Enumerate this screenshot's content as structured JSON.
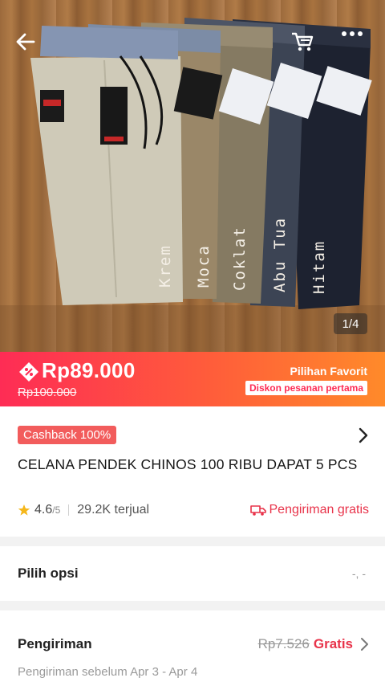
{
  "gallery": {
    "counter": "1/4",
    "color_labels": [
      "Krem",
      "Moca",
      "Coklat",
      "Abu Tua",
      "Hitam"
    ],
    "icons": [
      "back-arrow-icon",
      "cart-icon",
      "more-icon"
    ]
  },
  "price": {
    "current": "Rp89.000",
    "original": "Rp100.000",
    "favorite_label": "Pilihan Favorit",
    "first_order_badge": "Diskon pesanan pertama",
    "accent_color": "#fe2c55"
  },
  "product": {
    "cashback_badge": "Cashback 100%",
    "title": "CELANA PENDEK CHINOS 100 RIBU DAPAT 5 PCS",
    "rating": "4.6",
    "rating_max": "/5",
    "sold": "29.2K terjual",
    "free_shipping": "Pengiriman gratis"
  },
  "options": {
    "label": "Pilih opsi",
    "value": "-, -"
  },
  "shipping": {
    "label": "Pengiriman",
    "original_cost": "Rp7.526",
    "free_label": "Gratis",
    "eta": "Pengiriman sebelum Apr 3 - Apr 4"
  }
}
